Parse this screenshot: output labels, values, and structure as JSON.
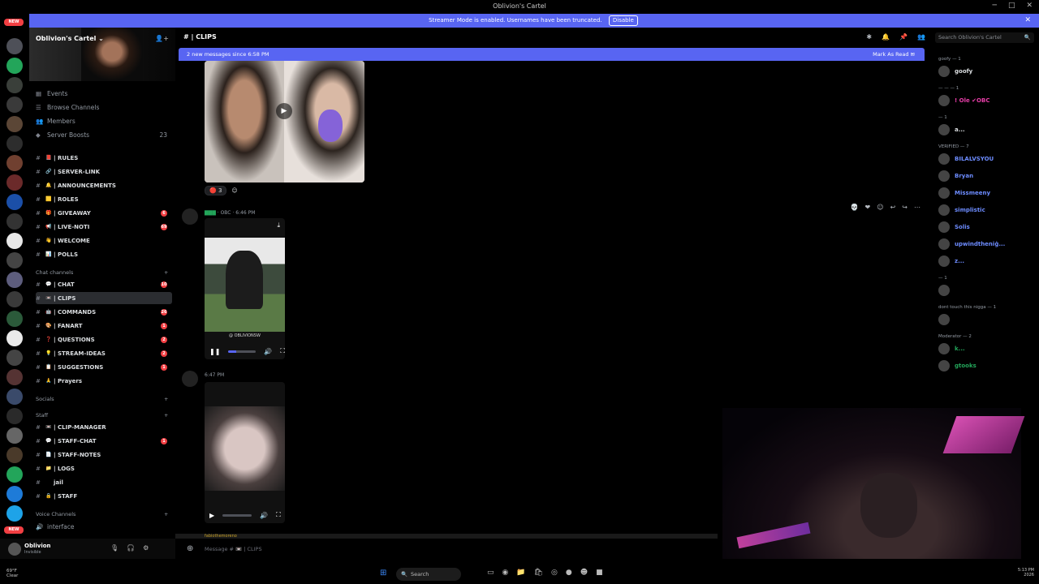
{
  "window": {
    "title": "Oblivion's Cartel"
  },
  "banner": {
    "text": "Streamer Mode is enabled. Usernames have been truncated.",
    "disable": "Disable",
    "close": "✕"
  },
  "rail": {
    "new_label": "NEW"
  },
  "server": {
    "name": "Oblivion's Cartel"
  },
  "sidebar": {
    "events": "Events",
    "browse": "Browse Channels",
    "members": "Members",
    "boosts": "Server Boosts",
    "boosts_count": "23",
    "channels": [
      {
        "name": "| RULES",
        "emo": "📕"
      },
      {
        "name": "| SERVER-LINK",
        "emo": "🔗"
      },
      {
        "name": "| ANNOUNCEMENTS",
        "emo": "🔔"
      },
      {
        "name": "| ROLES",
        "emo": "🟨"
      },
      {
        "name": "| GIVEAWAY",
        "emo": "🎁",
        "badge": "6"
      },
      {
        "name": "| LIVE-NOTI",
        "emo": "📢",
        "badge": "69"
      },
      {
        "name": "| WELCOME",
        "emo": "👋"
      },
      {
        "name": "| POLLS",
        "emo": "📊"
      }
    ],
    "chat_category": "Chat channels",
    "chat_channels": [
      {
        "name": "| CHAT",
        "emo": "💬",
        "badge": "10"
      },
      {
        "name": "| CLIPS",
        "emo": "📼"
      },
      {
        "name": "| COMMANDS",
        "emo": "🤖",
        "badge": "26"
      },
      {
        "name": "| FANART",
        "emo": "🎨",
        "badge": "1"
      },
      {
        "name": "| QUESTIONS",
        "emo": "❓",
        "badge": "2"
      },
      {
        "name": "| STREAM-IDEAS",
        "emo": "💡",
        "badge": "2"
      },
      {
        "name": "| SUGGESTIONS",
        "emo": "📋",
        "badge": "1"
      },
      {
        "name": "| Prayers",
        "emo": "🙏"
      }
    ],
    "socials": "Socials",
    "staff": "Staff",
    "staff_channels": [
      {
        "name": "| CLIP-MANAGER",
        "emo": "📼"
      },
      {
        "name": "| STAFF-CHAT",
        "emo": "💬",
        "badge": "1"
      },
      {
        "name": "| STAFF-NOTES",
        "emo": "📄"
      },
      {
        "name": "| LOGS",
        "emo": "📁"
      },
      {
        "name": "jail",
        "emo": ""
      },
      {
        "name": "| STAFF",
        "emo": "🔒"
      }
    ],
    "voice": "Voice Channels",
    "voice_first": "interface"
  },
  "user": {
    "name": "Oblivion",
    "status": "Invisible"
  },
  "header": {
    "channel": "| CLIPS"
  },
  "search": {
    "placeholder": "Search Oblivion's Cartel"
  },
  "newmsg": {
    "text": "2 new messages since 6:58 PM",
    "mark": "Mark As Read"
  },
  "messages": {
    "reaction_count": "3",
    "m1_time": "6:46 PM",
    "m1_label": "OBC",
    "m2_time": "6:47 PM",
    "vid1_caption": "@ OBLIVIONSW",
    "last_author": "fabiothemoreno"
  },
  "input": {
    "placeholder": "Message # 📼 | CLIPS"
  },
  "member_list": {
    "groups": [
      {
        "label": "goofy — 1",
        "members": [
          {
            "name": "goofy",
            "color": "#dbdee1"
          }
        ]
      },
      {
        "label": "— — — 1",
        "members": [
          {
            "name": "! Ole ✔OBC",
            "color": "#e83ea8"
          }
        ]
      },
      {
        "label": "— 1",
        "members": [
          {
            "name": "a...",
            "color": "#dbdee1"
          }
        ]
      },
      {
        "label": "VERIFIED — 7",
        "members": [
          {
            "name": "BILALVSYOU",
            "color": "#6d8cff"
          },
          {
            "name": "Bryan",
            "color": "#6d8cff"
          },
          {
            "name": "Missmeeny",
            "color": "#6d8cff"
          },
          {
            "name": "simplistic",
            "color": "#6d8cff"
          },
          {
            "name": "Solis",
            "color": "#6d8cff"
          },
          {
            "name": "upwindtheniġ...",
            "color": "#6d8cff"
          },
          {
            "name": "z...",
            "color": "#6d8cff"
          }
        ]
      },
      {
        "label": "— 1",
        "members": [
          {
            "name": "",
            "color": "#dbdee1"
          }
        ]
      },
      {
        "label": "dont touch this nigga — 1",
        "members": [
          {
            "name": "",
            "color": "#dbdee1"
          }
        ]
      },
      {
        "label": "Moderator — 2",
        "members": [
          {
            "name": "k...",
            "color": "#23a55a"
          },
          {
            "name": "gtooks",
            "color": "#23a55a"
          }
        ]
      }
    ]
  },
  "taskbar": {
    "search": "Search",
    "weather_temp": "69°F",
    "weather_desc": "Clear",
    "time": "5:13 PM",
    "date": "2026"
  }
}
